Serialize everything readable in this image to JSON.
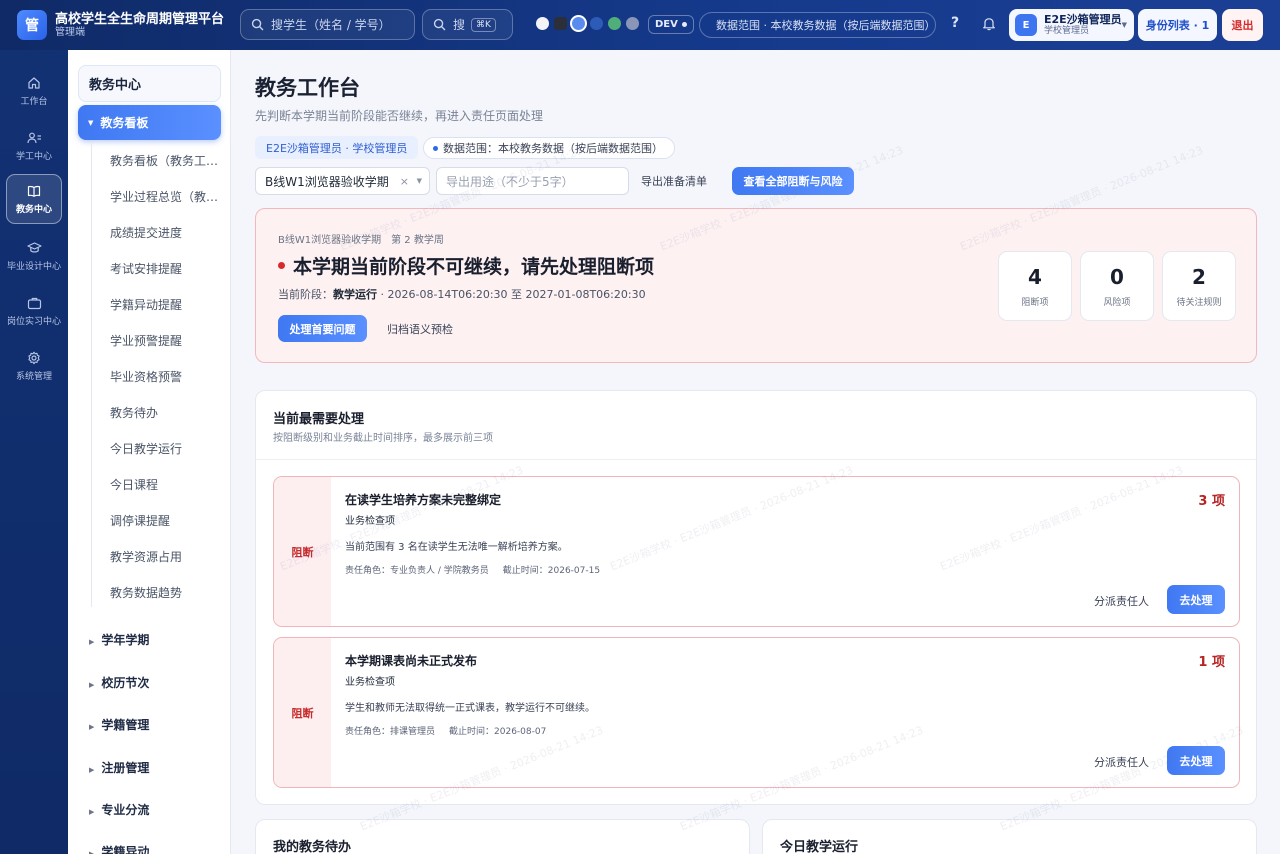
{
  "app": {
    "logo_char": "管",
    "title": "高校学生全生命周期管理平台",
    "subtitle": "管理端"
  },
  "topbar": {
    "search_student_placeholder": "搜学生（姓名 / 学号）",
    "search_placeholder": "搜",
    "search_shortcut": "⌘K",
    "theme_colors": [
      "#f2f4f8",
      "#2a2f3a",
      "#5a8cf0",
      "#2d5bb8",
      "#4fae7a",
      "#8a96b8"
    ],
    "env_label": "DEV",
    "scope_label": "数据范围 · 本校教务数据（按后端数据范围）",
    "help_label": "?",
    "user": {
      "avatar": "E",
      "name": "E2E沙箱管理员",
      "role": "学校管理员"
    },
    "identity_button": "身份列表 · 1",
    "logout_button": "退出"
  },
  "rail": [
    {
      "icon": "home-icon",
      "label": "工作台"
    },
    {
      "icon": "users-icon",
      "label": "学工中心"
    },
    {
      "icon": "book-icon",
      "label": "教务中心",
      "active": true
    },
    {
      "icon": "graduation-cap-icon",
      "label": "毕业设计中心"
    },
    {
      "icon": "briefcase-icon",
      "label": "岗位实习中心"
    },
    {
      "icon": "gear-icon",
      "label": "系统管理"
    }
  ],
  "subnav": {
    "title": "教务中心",
    "active_group": "教务看板",
    "items": [
      "教务看板（教务工作台）",
      "学业过程总览（教务）",
      "成绩提交进度",
      "考试安排提醒",
      "学籍异动提醒",
      "学业预警提醒",
      "毕业资格预警",
      "教务待办",
      "今日教学运行",
      "今日课程",
      "调停课提醒",
      "教学资源占用",
      "教务数据趋势"
    ],
    "groups": [
      "学年学期",
      "校历节次",
      "学籍管理",
      "注册管理",
      "专业分流",
      "学籍异动"
    ]
  },
  "page": {
    "title": "教务工作台",
    "subtitle": "先判断本学期当前阶段能否继续，再进入责任页面处理",
    "identity_tag": "E2E沙箱管理员 · 学校管理员",
    "scope_tag": "数据范围：本校教务数据（按后端数据范围）",
    "term_select": "B线W1浏览器验收学期",
    "purpose_placeholder": "导出用途（不少于5字）",
    "export_label": "导出准备清单",
    "view_all_button": "查看全部阻断与风险"
  },
  "alert": {
    "meta": "B线W1浏览器验收学期　第 2 教学周",
    "title": "本学期当前阶段不可继续，请先处理阻断项",
    "phase_prefix": "当前阶段：",
    "phase_name": "教学运行",
    "phase_range": " · 2026-08-14T06:20:30 至 2027-01-08T06:20:30",
    "primary_button": "处理首要问题",
    "secondary_button": "归档语义预检",
    "stats": [
      {
        "value": "4",
        "label": "阻断项"
      },
      {
        "value": "0",
        "label": "风险项"
      },
      {
        "value": "2",
        "label": "待关注规则"
      }
    ]
  },
  "priority": {
    "title": "当前最需要处理",
    "subtitle": "按阻断级别和业务截止时间排序，最多展示前三项",
    "issues": [
      {
        "level": "阻断",
        "title": "在读学生培养方案未完整绑定",
        "type": "业务检查项",
        "desc": "当前范围有 3 名在读学生无法唯一解析培养方案。",
        "owner": "责任角色：专业负责人 / 学院教务员",
        "deadline": "截止时间：2026-07-15",
        "count": "3 项",
        "assign": "分派责任人",
        "go": "去处理"
      },
      {
        "level": "阻断",
        "title": "本学期课表尚未正式发布",
        "type": "业务检查项",
        "desc": "学生和教师无法取得统一正式课表，教学运行不可继续。",
        "owner": "责任角色：排课管理员",
        "deadline": "截止时间：2026-08-07",
        "count": "1 项",
        "assign": "分派责任人",
        "go": "去处理"
      }
    ]
  },
  "bottom_cards": {
    "todo_title": "我的教务待办",
    "ops_title": "今日教学运行"
  },
  "watermark": "E2E沙箱学校 · E2E沙箱管理员 · 2026-08-21 14:23"
}
